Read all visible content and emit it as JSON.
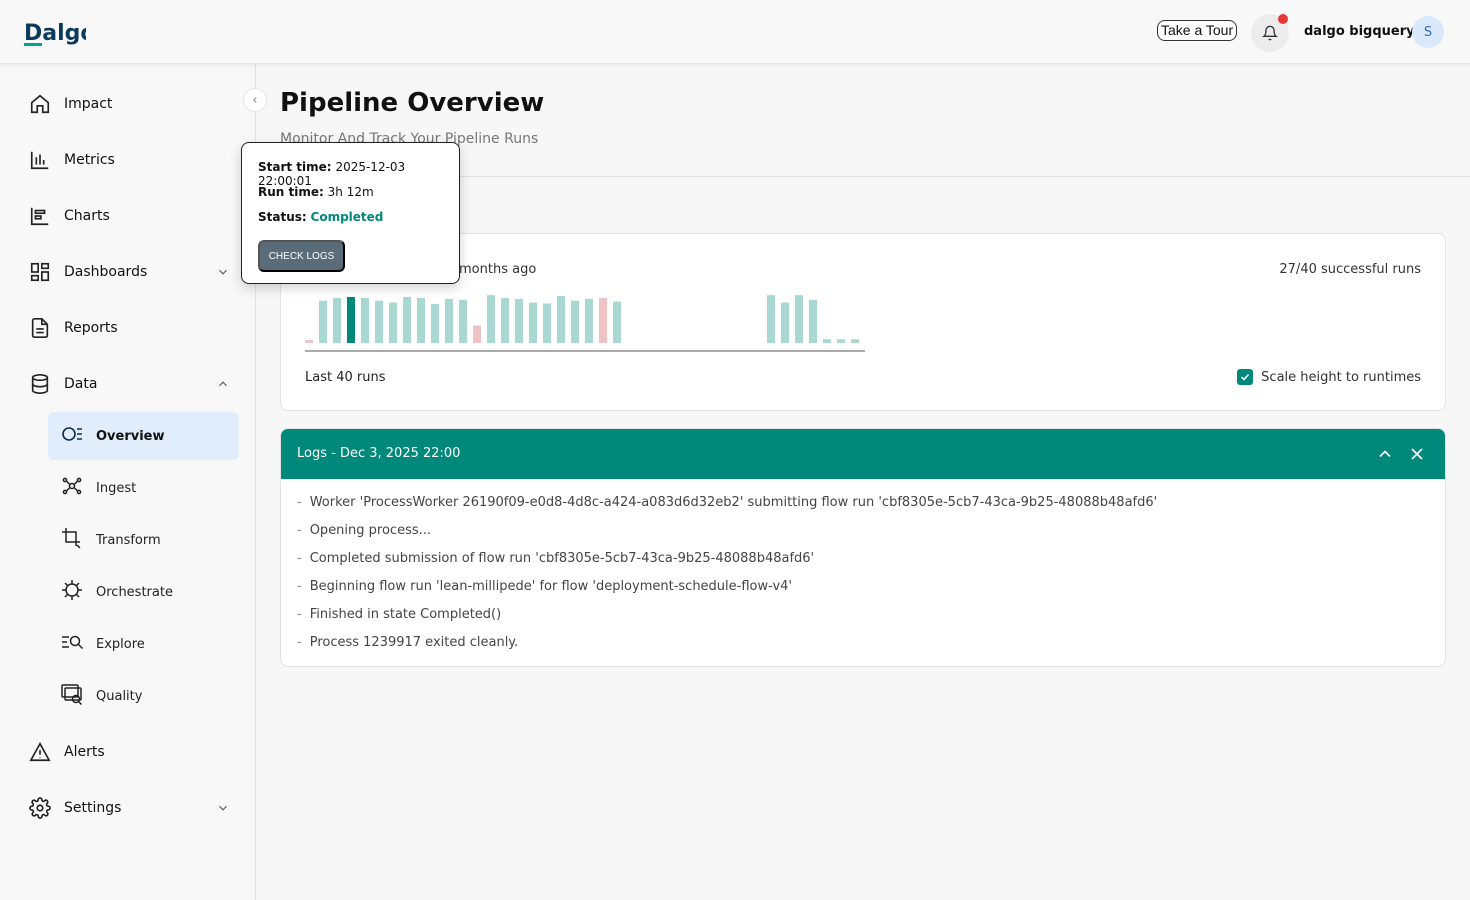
{
  "header": {
    "logo_text": "Dalgo",
    "tour_label": "Take a Tour",
    "org_name": "dalgo bigquery",
    "avatar_initial": "S"
  },
  "sidebar": {
    "items": [
      {
        "label": "Impact",
        "icon": "home-icon"
      },
      {
        "label": "Metrics",
        "icon": "bar-chart-icon"
      },
      {
        "label": "Charts",
        "icon": "chart-icon"
      },
      {
        "label": "Dashboards",
        "icon": "grid-icon"
      },
      {
        "label": "Reports",
        "icon": "document-icon"
      },
      {
        "label": "Data",
        "icon": "database-icon"
      },
      {
        "label": "Alerts",
        "icon": "warning-icon"
      },
      {
        "label": "Settings",
        "icon": "gear-icon"
      }
    ],
    "data_children": [
      {
        "label": "Overview",
        "icon": "overview-icon"
      },
      {
        "label": "Ingest",
        "icon": "ingest-icon"
      },
      {
        "label": "Transform",
        "icon": "transform-icon"
      },
      {
        "label": "Orchestrate",
        "icon": "orchestrate-icon"
      },
      {
        "label": "Explore",
        "icon": "explore-icon"
      },
      {
        "label": "Quality",
        "icon": "quality-icon"
      }
    ]
  },
  "main": {
    "title": "Pipeline Overview",
    "subtitle": "Monitor And Track Your Pipeline Runs",
    "last_run_text": "months ago",
    "success_runs": "27/40 successful runs",
    "runs_label": "Last 40 runs",
    "scale_label": "Scale height to runtimes",
    "scale_checked": true
  },
  "chart_data": {
    "type": "bar",
    "title": "",
    "xlabel": "",
    "ylabel": "",
    "colors": {
      "success": "#a8d8d1",
      "failed": "#efc3c6",
      "selected": "#00897b"
    },
    "runs": [
      {
        "h": 0.06,
        "s": "failed"
      },
      {
        "h": 0.92,
        "s": "success"
      },
      {
        "h": 0.98,
        "s": "success"
      },
      {
        "h": 1.0,
        "s": "selected"
      },
      {
        "h": 0.98,
        "s": "success"
      },
      {
        "h": 0.92,
        "s": "success"
      },
      {
        "h": 0.88,
        "s": "success"
      },
      {
        "h": 1.0,
        "s": "success"
      },
      {
        "h": 0.98,
        "s": "success"
      },
      {
        "h": 0.85,
        "s": "success"
      },
      {
        "h": 0.96,
        "s": "success"
      },
      {
        "h": 0.94,
        "s": "success"
      },
      {
        "h": 0.38,
        "s": "failed"
      },
      {
        "h": 1.04,
        "s": "success"
      },
      {
        "h": 0.98,
        "s": "success"
      },
      {
        "h": 0.96,
        "s": "success"
      },
      {
        "h": 0.88,
        "s": "success"
      },
      {
        "h": 0.86,
        "s": "success"
      },
      {
        "h": 1.02,
        "s": "success"
      },
      {
        "h": 0.92,
        "s": "success"
      },
      {
        "h": 0.96,
        "s": "success"
      },
      {
        "h": 0.98,
        "s": "failed"
      },
      {
        "h": 0.9,
        "s": "success"
      },
      {
        "h": 0.0,
        "s": "none"
      },
      {
        "h": 0.0,
        "s": "none"
      },
      {
        "h": 0.0,
        "s": "none"
      },
      {
        "h": 0.0,
        "s": "none"
      },
      {
        "h": 0.0,
        "s": "none"
      },
      {
        "h": 0.0,
        "s": "none"
      },
      {
        "h": 0.0,
        "s": "none"
      },
      {
        "h": 0.0,
        "s": "none"
      },
      {
        "h": 0.0,
        "s": "none"
      },
      {
        "h": 0.0,
        "s": "none"
      },
      {
        "h": 1.04,
        "s": "success"
      },
      {
        "h": 0.88,
        "s": "success"
      },
      {
        "h": 1.04,
        "s": "success"
      },
      {
        "h": 0.94,
        "s": "success"
      },
      {
        "h": 0.08,
        "s": "success"
      },
      {
        "h": 0.08,
        "s": "success"
      },
      {
        "h": 0.08,
        "s": "success"
      }
    ]
  },
  "logs": {
    "title": "Logs - Dec 3, 2025 22:00",
    "lines": [
      "Worker 'ProcessWorker 26190f09-e0d8-4d8c-a424-a083d6d32eb2' submitting flow run 'cbf8305e-5cb7-43ca-9b25-48088b48afd6'",
      "Opening process...",
      "Completed submission of flow run 'cbf8305e-5cb7-43ca-9b25-48088b48afd6'",
      "Beginning flow run 'lean-millipede' for flow 'deployment-schedule-flow-v4'",
      "Finished in state Completed()",
      "Process 1239917 exited cleanly."
    ]
  },
  "tooltip": {
    "start_label": "Start time:",
    "start_value": "2025-12-03 22:00:01",
    "run_label": "Run time:",
    "run_value": "3h 12m",
    "status_label": "Status:",
    "status_value": "Completed",
    "button_label": "CHECK LOGS"
  }
}
